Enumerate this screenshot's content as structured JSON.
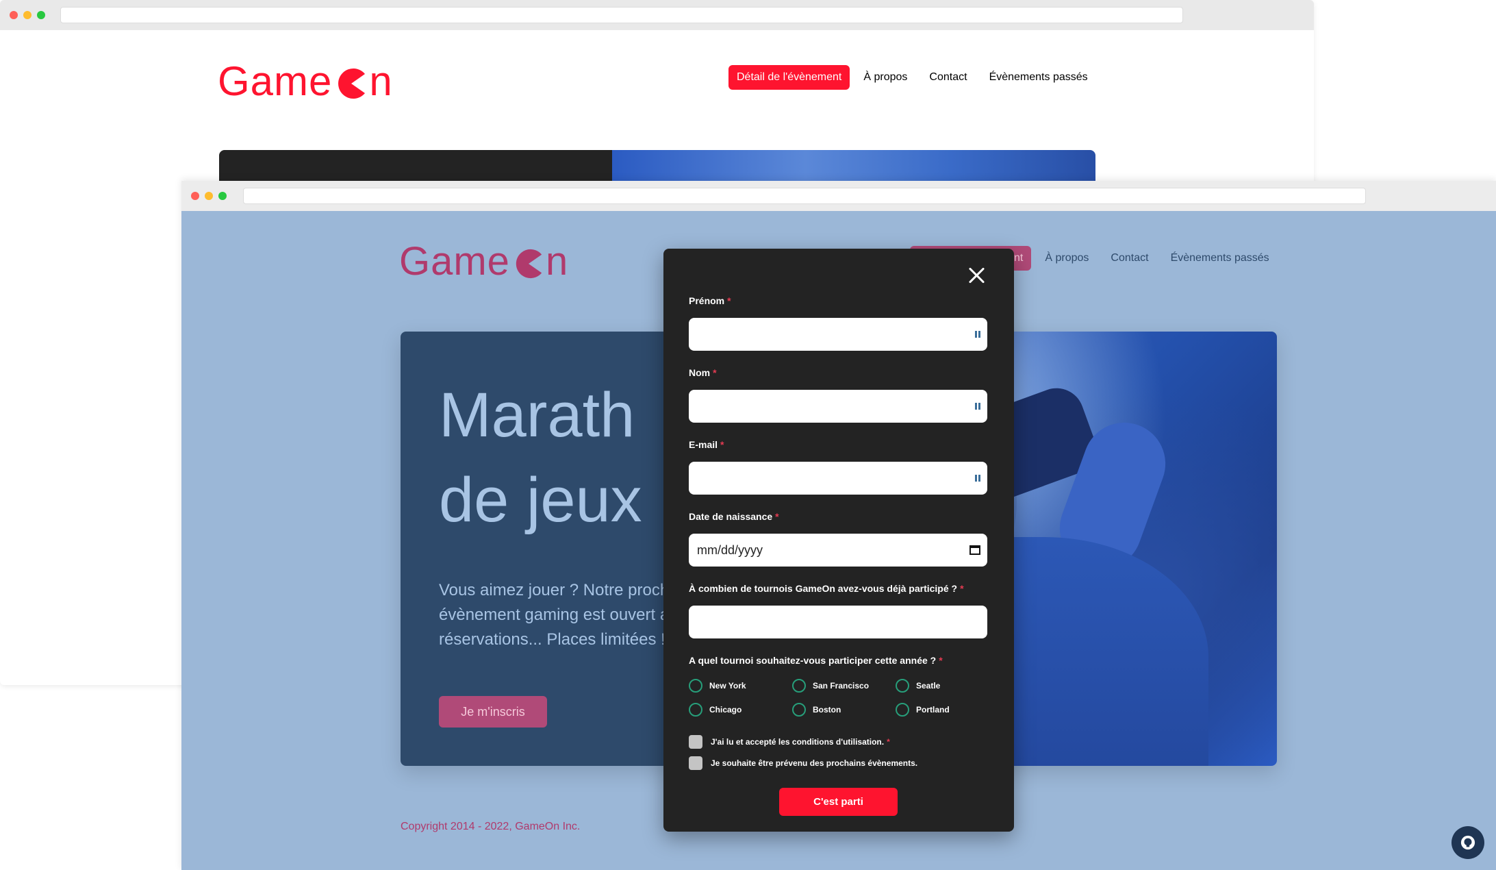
{
  "brand": {
    "name_part1": "Game",
    "name_part2": "n",
    "color_back": "#fe142f",
    "color_front": "#b03a6c"
  },
  "nav": {
    "items": [
      {
        "label": "Détail de l'évènement",
        "active": true
      },
      {
        "label": "À propos",
        "active": false
      },
      {
        "label": "Contact",
        "active": false
      },
      {
        "label": "Évènements passés",
        "active": false
      }
    ]
  },
  "hero": {
    "title": "Marathon\nde jeux",
    "title_visible": "Marath",
    "title_line2_visible": "de jeux",
    "text_line1": "Vous aimez jouer ? Notre proch",
    "text_line2": "évènement gaming est ouvert a",
    "text_line3": "réservations... Places limitées !",
    "cta_label": "Je m'inscris"
  },
  "footer": {
    "copyright": "Copyright 2014 - 2022, GameOn Inc."
  },
  "modal": {
    "first_name_label": "Prénom",
    "last_name_label": "Nom",
    "email_label": "E-mail",
    "birthdate_label": "Date de naissance",
    "birthdate_placeholder": "mm/dd/yyyy",
    "tournaments_count_label": "À combien de tournois GameOn avez-vous déjà participé ?",
    "location_question": "A quel tournoi souhaitez-vous participer cette année ?",
    "required_mark": "*",
    "locations": [
      "New York",
      "San Francisco",
      "Seatle",
      "Chicago",
      "Boston",
      "Portland"
    ],
    "terms_label": "J'ai lu et accepté les conditions d'utilisation.",
    "newsletter_label": "Je souhaite être prévenu des prochains évènements.",
    "submit_label": "C'est parti"
  }
}
